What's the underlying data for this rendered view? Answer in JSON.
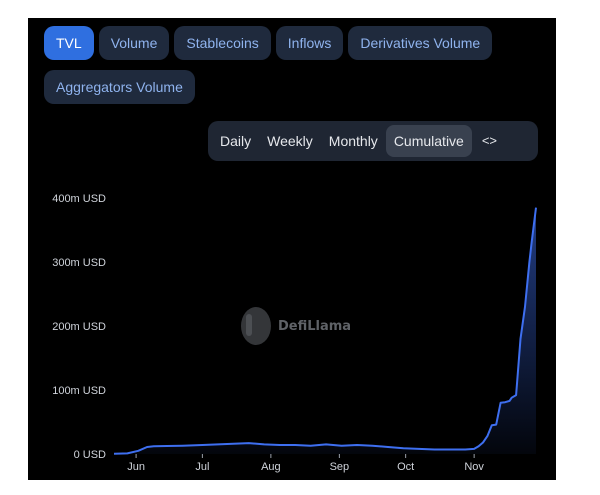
{
  "tabs": [
    {
      "label": "TVL",
      "active": true
    },
    {
      "label": "Volume",
      "active": false
    },
    {
      "label": "Stablecoins",
      "active": false
    },
    {
      "label": "Inflows",
      "active": false
    },
    {
      "label": "Derivatives Volume",
      "active": false
    },
    {
      "label": "Aggregators Volume",
      "active": false
    }
  ],
  "periods": [
    {
      "label": "Daily",
      "active": false
    },
    {
      "label": "Weekly",
      "active": false
    },
    {
      "label": "Monthly",
      "active": false
    },
    {
      "label": "Cumulative",
      "active": true
    }
  ],
  "embed_icon": "code-icon",
  "embed_glyph": "<>",
  "watermark": "DefiLlama",
  "colors": {
    "background": "#000000",
    "line": "#3e6ff0",
    "accent": "#2f6fe0"
  },
  "chart_data": {
    "type": "area",
    "x_ticks": [
      "Jun",
      "Jul",
      "Aug",
      "Sep",
      "Oct",
      "Nov"
    ],
    "y_ticks": [
      "0 USD",
      "100m USD",
      "200m USD",
      "300m USD",
      "400m USD"
    ],
    "y_tick_values": [
      0,
      100,
      200,
      300,
      400
    ],
    "ylim": [
      0,
      400
    ],
    "xlim": [
      "2023-05-22",
      "2023-11-29"
    ],
    "unit": "m USD",
    "grid": false,
    "series": [
      {
        "x": [
          "2023-05-22",
          "2023-05-28",
          "2023-06-02",
          "2023-06-06",
          "2023-06-09",
          "2023-06-15",
          "2023-06-22",
          "2023-07-01",
          "2023-07-08",
          "2023-07-15",
          "2023-07-22",
          "2023-07-29",
          "2023-08-05",
          "2023-08-12",
          "2023-08-19",
          "2023-08-26",
          "2023-09-02",
          "2023-09-09",
          "2023-09-16",
          "2023-09-23",
          "2023-09-30",
          "2023-10-07",
          "2023-10-14",
          "2023-10-21",
          "2023-10-28",
          "2023-11-01",
          "2023-11-03",
          "2023-11-05",
          "2023-11-07",
          "2023-11-09",
          "2023-11-11",
          "2023-11-13",
          "2023-11-15",
          "2023-11-17",
          "2023-11-18",
          "2023-11-20",
          "2023-11-22",
          "2023-11-24",
          "2023-11-26",
          "2023-11-27",
          "2023-11-29"
        ],
        "y": [
          0.5,
          1,
          5,
          11,
          12,
          12.5,
          13,
          14,
          15,
          16,
          17,
          15,
          14,
          14,
          13,
          15,
          13,
          14,
          13,
          11,
          9,
          8,
          7,
          7,
          7,
          8,
          12,
          18,
          28,
          45,
          46,
          80,
          81,
          83,
          88,
          92,
          180,
          230,
          300,
          330,
          385
        ]
      }
    ]
  }
}
